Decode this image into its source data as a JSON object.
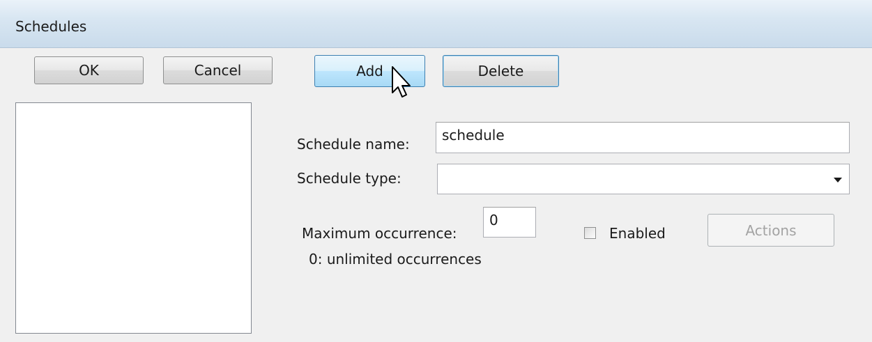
{
  "window": {
    "title": "Schedules"
  },
  "toolbar": {
    "ok_label": "OK",
    "cancel_label": "Cancel",
    "add_label": "Add",
    "delete_label": "Delete"
  },
  "form": {
    "schedule_name_label": "Schedule name:",
    "schedule_name_value": "schedule",
    "schedule_type_label": "Schedule type:",
    "schedule_type_value": "",
    "max_occurrence_label": "Maximum occurrence:",
    "max_occurrence_value": "0",
    "max_occurrence_hint": "0: unlimited occurrences",
    "enabled_label": "Enabled",
    "enabled_checked": false,
    "actions_label": "Actions"
  },
  "icons": {
    "combo_arrow": "chevron-down-icon",
    "cursor": "mouse-pointer-icon"
  }
}
